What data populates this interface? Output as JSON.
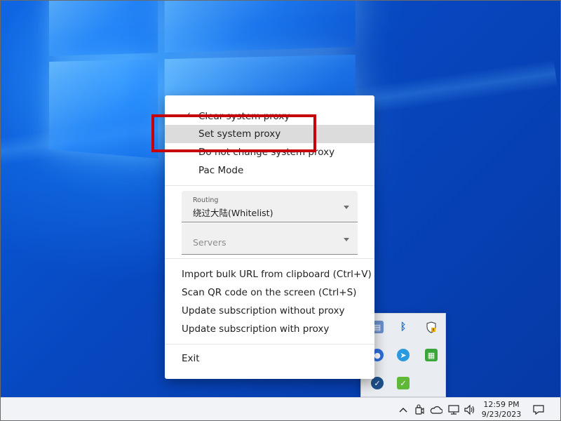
{
  "menu": {
    "proxy_modes": [
      {
        "label": "Clear system proxy",
        "checked": true
      },
      {
        "label": "Set system proxy",
        "checked": false,
        "hovered": true
      },
      {
        "label": "Do not change system proxy",
        "checked": false
      },
      {
        "label": "Pac Mode",
        "checked": false
      }
    ],
    "check_glyph": "✓",
    "routing": {
      "label": "Routing",
      "value": "绕过大陆(Whitelist)"
    },
    "servers": {
      "placeholder": "Servers"
    },
    "actions": [
      {
        "label": "Import bulk URL from clipboard (Ctrl+V)"
      },
      {
        "label": "Scan QR code on the screen (Ctrl+S)"
      },
      {
        "label": "Update subscription without proxy"
      },
      {
        "label": "Update subscription with proxy"
      }
    ],
    "exit_label": "Exit"
  },
  "tray_overflow": {
    "icons": [
      "app-window-icon",
      "bluetooth-icon",
      "windows-security-icon",
      "meeting-app-icon",
      "telegram-icon",
      "green-grid-app-icon",
      "v2rayn-icon",
      "green-check-app-icon"
    ]
  },
  "taskbar": {
    "icons": [
      "show-hidden-icons-chevron",
      "meet-now-icon",
      "onedrive-icon",
      "network-icon",
      "volume-icon"
    ],
    "time": "12:59 PM",
    "date": "9/23/2023",
    "notification_icon": "action-center-icon"
  },
  "colors": {
    "annotation": "#c5000b",
    "hover_bg": "#dcdcdc",
    "wallpaper": "#0747bf"
  }
}
